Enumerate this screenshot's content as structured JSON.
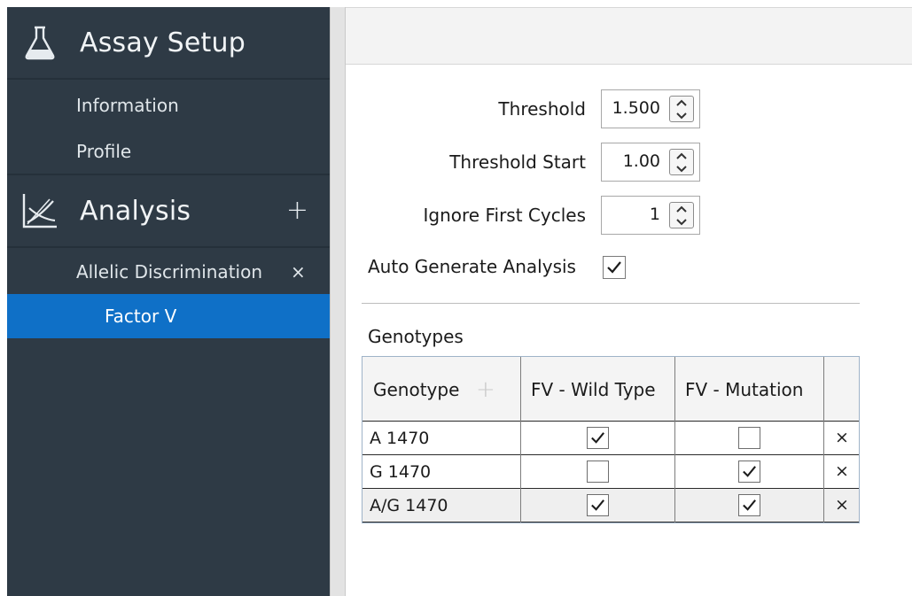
{
  "sidebar": {
    "assay_setup": {
      "title": "Assay Setup",
      "icon": "flask-icon"
    },
    "setup_items": [
      {
        "label": "Information"
      },
      {
        "label": "Profile"
      }
    ],
    "analysis": {
      "title": "Analysis",
      "icon": "chart-analysis-icon",
      "add_label": "+"
    },
    "analysis_items": [
      {
        "label": "Allelic Discrimination",
        "close_label": "×"
      },
      {
        "label": "Factor V",
        "active": true
      }
    ]
  },
  "settings": {
    "threshold": {
      "label": "Threshold",
      "value": "1.500"
    },
    "threshold_start": {
      "label": "Threshold Start",
      "value": "1.00"
    },
    "ignore_first_cycles": {
      "label": "Ignore First Cycles",
      "value": "1"
    },
    "auto_generate": {
      "label": "Auto Generate Analysis",
      "checked": true
    }
  },
  "genotypes": {
    "title": "Genotypes",
    "columns": [
      "Genotype",
      "FV - Wild Type",
      "FV - Mutation"
    ],
    "add_label": "+",
    "rows": [
      {
        "name": "A 1470",
        "wild_type": true,
        "mutation": false,
        "delete_label": "×"
      },
      {
        "name": "G 1470",
        "wild_type": false,
        "mutation": true,
        "delete_label": "×"
      },
      {
        "name": "A/G 1470",
        "wild_type": true,
        "mutation": true,
        "delete_label": "×"
      }
    ]
  },
  "colors": {
    "sidebar_bg": "#2e3a45",
    "active_item": "#0f70c7",
    "text_dark": "#1b1b1b"
  }
}
